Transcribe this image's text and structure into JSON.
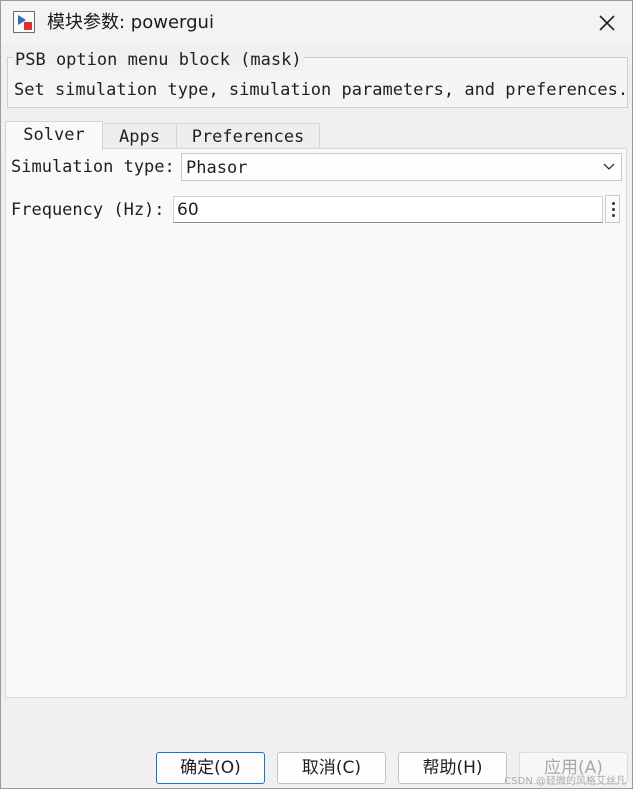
{
  "window": {
    "title": "模块参数: powergui"
  },
  "mask": {
    "title": "PSB option menu block (mask)",
    "description": "Set simulation type, simulation parameters, and preferences."
  },
  "tabs": [
    {
      "label": "Solver",
      "active": true
    },
    {
      "label": "Apps",
      "active": false
    },
    {
      "label": "Preferences",
      "active": false
    }
  ],
  "solver": {
    "simulation_type_label": "Simulation type:",
    "simulation_type_value": "Phasor",
    "frequency_label": "Frequency (Hz):",
    "frequency_value": "60"
  },
  "buttons": {
    "ok": "确定(O)",
    "cancel": "取消(C)",
    "help": "帮助(H)",
    "apply": "应用(A)"
  },
  "watermark": "CSDN @轻微的风格艾丝凡",
  "colors": {
    "accent": "#1f6fd1",
    "icon_blue": "#2b6cc4",
    "icon_red": "#d9342b"
  },
  "icons": {
    "app": "simulink-block-icon",
    "close": "close-icon",
    "dropdown": "chevron-down-icon",
    "more": "more-vertical-icon"
  }
}
